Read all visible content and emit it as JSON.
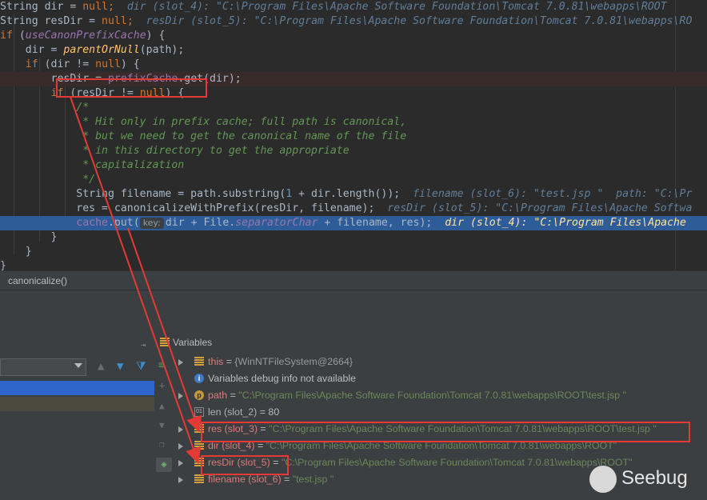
{
  "editor": {
    "lines": [
      {
        "id": "l0",
        "parts": [
          {
            "t": "String dir = ",
            "c": ""
          },
          {
            "t": "null",
            "c": "kw"
          },
          {
            "t": ";  ",
            "c": "kw"
          },
          {
            "t": "dir (slot_4): \"C:\\Program Files\\Apache Software Foundation\\Tomcat 7.0.81\\webapps\\ROOT",
            "c": "dbg"
          }
        ]
      },
      {
        "id": "l1",
        "parts": [
          {
            "t": "String resDir = ",
            "c": ""
          },
          {
            "t": "null",
            "c": "kw"
          },
          {
            "t": ";  ",
            "c": "kw"
          },
          {
            "t": "resDir (slot_5): \"C:\\Program Files\\Apache Software Foundation\\Tomcat 7.0.81\\webapps\\RO",
            "c": "dbg"
          }
        ]
      },
      {
        "id": "l2",
        "parts": [
          {
            "t": "if ",
            "c": "kw"
          },
          {
            "t": "(",
            "c": ""
          },
          {
            "t": "useCanonPrefixCache",
            "c": "sfld"
          },
          {
            "t": ") {",
            "c": ""
          }
        ]
      },
      {
        "id": "l3",
        "parts": [
          {
            "t": "    dir = ",
            "c": ""
          },
          {
            "t": "parentOrNull",
            "c": "fn"
          },
          {
            "t": "(path);",
            "c": ""
          }
        ]
      },
      {
        "id": "l4",
        "parts": [
          {
            "t": "    ",
            "c": ""
          },
          {
            "t": "if ",
            "c": "kw"
          },
          {
            "t": "(dir != ",
            "c": ""
          },
          {
            "t": "null",
            "c": "kw"
          },
          {
            "t": ") {",
            "c": ""
          }
        ]
      },
      {
        "id": "l5",
        "parts": [
          {
            "t": "        resDir = ",
            "c": ""
          },
          {
            "t": "prefixCache",
            "c": "fld"
          },
          {
            "t": ".get(dir);",
            "c": ""
          }
        ]
      },
      {
        "id": "l6",
        "parts": [
          {
            "t": "        ",
            "c": ""
          },
          {
            "t": "if ",
            "c": "kw"
          },
          {
            "t": "(resDir != ",
            "c": ""
          },
          {
            "t": "null",
            "c": "kw"
          },
          {
            "t": ") {",
            "c": ""
          }
        ]
      },
      {
        "id": "l7",
        "parts": [
          {
            "t": "            /*",
            "c": "cmt"
          }
        ]
      },
      {
        "id": "l8",
        "parts": [
          {
            "t": "             * Hit only in prefix cache; full path is canonical,",
            "c": "cmt"
          }
        ]
      },
      {
        "id": "l9",
        "parts": [
          {
            "t": "             * but we need to get the canonical name of the file",
            "c": "cmt"
          }
        ]
      },
      {
        "id": "l10",
        "parts": [
          {
            "t": "             * in this directory to get the appropriate",
            "c": "cmt"
          }
        ]
      },
      {
        "id": "l11",
        "parts": [
          {
            "t": "             * capitalization",
            "c": "cmt"
          }
        ]
      },
      {
        "id": "l12",
        "parts": [
          {
            "t": "             */",
            "c": "cmt"
          }
        ]
      },
      {
        "id": "l13",
        "parts": [
          {
            "t": "            String filename = path.substring(",
            "c": ""
          },
          {
            "t": "1",
            "c": "num"
          },
          {
            "t": " + dir.length());  ",
            "c": ""
          },
          {
            "t": "filename (slot_6): \"test.jsp \"  path: \"C:\\Pr",
            "c": "dbg"
          }
        ]
      },
      {
        "id": "l14",
        "parts": [
          {
            "t": "            res = canonicalizeWithPrefix(resDir, filename);  ",
            "c": ""
          },
          {
            "t": "resDir (slot_5): \"C:\\Program Files\\Apache Softwa",
            "c": "dbg"
          }
        ]
      },
      {
        "id": "l15",
        "parts": [
          {
            "t": "            ",
            "c": ""
          },
          {
            "t": "cache",
            "c": "fld"
          },
          {
            "t": ".put(",
            "c": ""
          },
          {
            "t": "key:",
            "c": "hint"
          },
          {
            "t": "dir + File.",
            "c": ""
          },
          {
            "t": "separatorChar",
            "c": "sfld"
          },
          {
            "t": " + filename, res);  ",
            "c": ""
          },
          {
            "t": "dir (slot_4): \"C:\\Program Files\\Apache",
            "c": "hl-dbg"
          }
        ]
      },
      {
        "id": "l16",
        "parts": [
          {
            "t": "        }",
            "c": ""
          }
        ]
      },
      {
        "id": "l17",
        "parts": [
          {
            "t": "    }",
            "c": ""
          }
        ]
      },
      {
        "id": "l18",
        "parts": [
          {
            "t": "}",
            "c": ""
          }
        ]
      }
    ]
  },
  "breadcrumb": {
    "method": "canonicalize()"
  },
  "variables": {
    "title": "Variables",
    "rows": [
      {
        "expand": true,
        "icon": "stack",
        "name": "this",
        "eq": " = ",
        "value": "{WinNTFileSystem@2664}",
        "vclass": "vobj",
        "nclass": "vname"
      },
      {
        "expand": false,
        "icon": "info",
        "name": "",
        "eq": "",
        "value": "Variables debug info not available",
        "vclass": "vnum",
        "nclass": "vname2"
      },
      {
        "expand": true,
        "icon": "param",
        "name": "path",
        "eq": " = ",
        "value": "\"C:\\Program Files\\Apache Software Foundation\\Tomcat 7.0.81\\webapps\\ROOT\\test.jsp \"",
        "vclass": "vval",
        "nclass": "vname"
      },
      {
        "expand": false,
        "icon": "array",
        "name": "len (slot_2)",
        "eq": " = ",
        "value": "80",
        "vclass": "vnum",
        "nclass": "vname2"
      },
      {
        "expand": true,
        "icon": "stack",
        "name": "res (slot_3)",
        "eq": " = ",
        "value": "\"C:\\Program Files\\Apache Software Foundation\\Tomcat 7.0.81\\webapps\\ROOT\\test.jsp \"",
        "vclass": "vval",
        "nclass": "vname"
      },
      {
        "expand": true,
        "icon": "stack",
        "name": "dir (slot_4)",
        "eq": " = ",
        "value": "\"C:\\Program Files\\Apache Software Foundation\\Tomcat 7.0.81\\webapps\\ROOT\"",
        "vclass": "vval",
        "nclass": "vname"
      },
      {
        "expand": true,
        "icon": "stack",
        "name": "resDir (slot_5)",
        "eq": " = ",
        "value": "\"C:\\Program Files\\Apache Software Foundation\\Tomcat 7.0.81\\webapps\\ROOT\"",
        "vclass": "vval",
        "nclass": "vname"
      },
      {
        "expand": true,
        "icon": "stack",
        "name": "filename (slot_6)",
        "eq": " = ",
        "value": "\"test.jsp \"",
        "vclass": "vval",
        "nclass": "vname"
      }
    ]
  },
  "watermark": {
    "text": "Seebug"
  },
  "colors": {
    "annotation": "#e53935",
    "selected_line": "#2e5c99",
    "breakpoint_line": "#3a2b2b"
  }
}
